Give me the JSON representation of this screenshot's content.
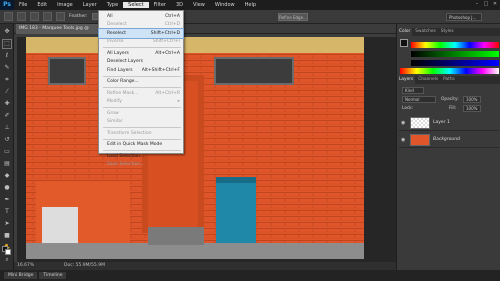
{
  "app": {
    "logo": "Ps",
    "window_controls": [
      "–",
      "□",
      "✕"
    ]
  },
  "menubar": {
    "items": [
      "File",
      "Edit",
      "Image",
      "Layer",
      "Type",
      "Select",
      "Filter",
      "3D",
      "View",
      "Window",
      "Help"
    ],
    "active_index": 5
  },
  "options_bar": {
    "feather_label": "Feather:",
    "refine_edge": "Refine Edge...",
    "workspace": "Photoshop J..."
  },
  "document": {
    "tab_title": "IMG 183 - Marquee Tools.jpg @ 16.7% (RGB/8)",
    "zoom": "16.67%",
    "doc_size": "Doc: 55.9M/55.9M"
  },
  "select_menu": {
    "items": [
      {
        "label": "All",
        "shortcut": "Ctrl+A",
        "disabled": false
      },
      {
        "label": "Deselect",
        "shortcut": "Ctrl+D",
        "disabled": true
      },
      {
        "label": "Reselect",
        "shortcut": "Shift+Ctrl+D",
        "disabled": false,
        "highlighted": true
      },
      {
        "label": "Inverse",
        "shortcut": "Shift+Ctrl+I",
        "disabled": true
      },
      {
        "sep": true
      },
      {
        "label": "All Layers",
        "shortcut": "Alt+Ctrl+A",
        "disabled": false
      },
      {
        "label": "Deselect Layers",
        "shortcut": "",
        "disabled": false
      },
      {
        "label": "Find Layers",
        "shortcut": "Alt+Shift+Ctrl+F",
        "disabled": false
      },
      {
        "sep": true
      },
      {
        "label": "Color Range...",
        "shortcut": "",
        "disabled": false
      },
      {
        "sep": true
      },
      {
        "label": "Refine Mask...",
        "shortcut": "Alt+Ctrl+R",
        "disabled": true
      },
      {
        "label": "Modify",
        "shortcut": "▸",
        "disabled": true
      },
      {
        "sep": true
      },
      {
        "label": "Grow",
        "shortcut": "",
        "disabled": true
      },
      {
        "label": "Similar",
        "shortcut": "",
        "disabled": true
      },
      {
        "sep": true
      },
      {
        "label": "Transform Selection",
        "shortcut": "",
        "disabled": true
      },
      {
        "sep": true
      },
      {
        "label": "Edit in Quick Mask Mode",
        "shortcut": "",
        "disabled": false
      },
      {
        "sep": true
      },
      {
        "label": "Load Selection...",
        "shortcut": "",
        "disabled": false
      },
      {
        "label": "Save Selection...",
        "shortcut": "",
        "disabled": true
      }
    ]
  },
  "right_panel": {
    "top_tabs": [
      "Color",
      "Swatches",
      "Styles"
    ],
    "layer_tabs": [
      "Layers",
      "Channels",
      "Paths"
    ],
    "kind": "Kind",
    "blend_mode": "Normal",
    "opacity_label": "Opacity:",
    "opacity_value": "100%",
    "lock_label": "Lock:",
    "fill_label": "Fill:",
    "fill_value": "100%",
    "layers": [
      {
        "name": "Layer 1",
        "thumb": "transparent"
      },
      {
        "name": "Background",
        "thumb": "photo"
      }
    ]
  },
  "bottom_tabs": [
    "Mini Bridge",
    "Timeline"
  ],
  "colors": {
    "brick": "#e0562a",
    "door": "#d84f22",
    "bin": "#1f87a8",
    "menu_highlight": "#cfe3f7"
  }
}
